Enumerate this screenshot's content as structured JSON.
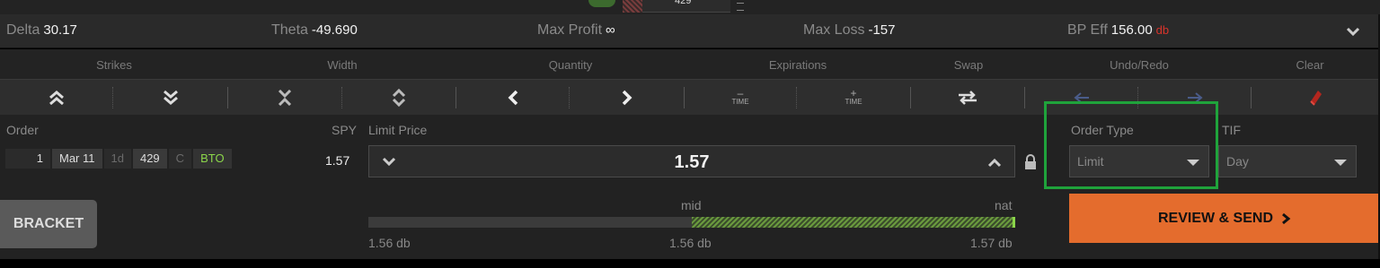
{
  "top_tab": {
    "text": "429"
  },
  "greeks": {
    "delta_label": "Delta",
    "delta_value": "30.17",
    "theta_label": "Theta",
    "theta_value": "-49.690",
    "maxprofit_label": "Max Profit",
    "maxprofit_value": "∞",
    "maxloss_label": "Max Loss",
    "maxloss_value": "-157",
    "bp_label": "BP Eff",
    "bp_value": "156.00",
    "bp_suffix": "db"
  },
  "toolbar": {
    "strikes_label": "Strikes",
    "width_label": "Width",
    "quantity_label": "Quantity",
    "expirations_label": "Expirations",
    "swap_label": "Swap",
    "undo_redo_label": "Undo/Redo",
    "clear_label": "Clear",
    "time_minus": "TIME",
    "time_plus": "TIME"
  },
  "order": {
    "order_label": "Order",
    "underlying": "SPY",
    "leg": {
      "qty": "1",
      "expiration": "Mar 11",
      "dte": "1d",
      "strike": "429",
      "type": "C",
      "action": "BTO"
    },
    "leg_price": "1.57",
    "limit_price_label": "Limit Price",
    "limit_price_value": "1.57",
    "order_type_label": "Order Type",
    "order_type_value": "Limit",
    "tif_label": "TIF",
    "tif_value": "Day",
    "bracket_label": "BRACKET",
    "slider": {
      "mid_label": "mid",
      "nat_label": "nat",
      "left_value": "1.56 db",
      "mid_value": "1.56 db",
      "right_value": "1.57 db",
      "fill_fraction": 0.5
    },
    "review_send_label": "REVIEW & SEND"
  },
  "colors": {
    "accent": "#e46c2d",
    "highlight": "#1fa33b",
    "credit_green": "#8bd64a",
    "debit_red": "#d9342b"
  }
}
